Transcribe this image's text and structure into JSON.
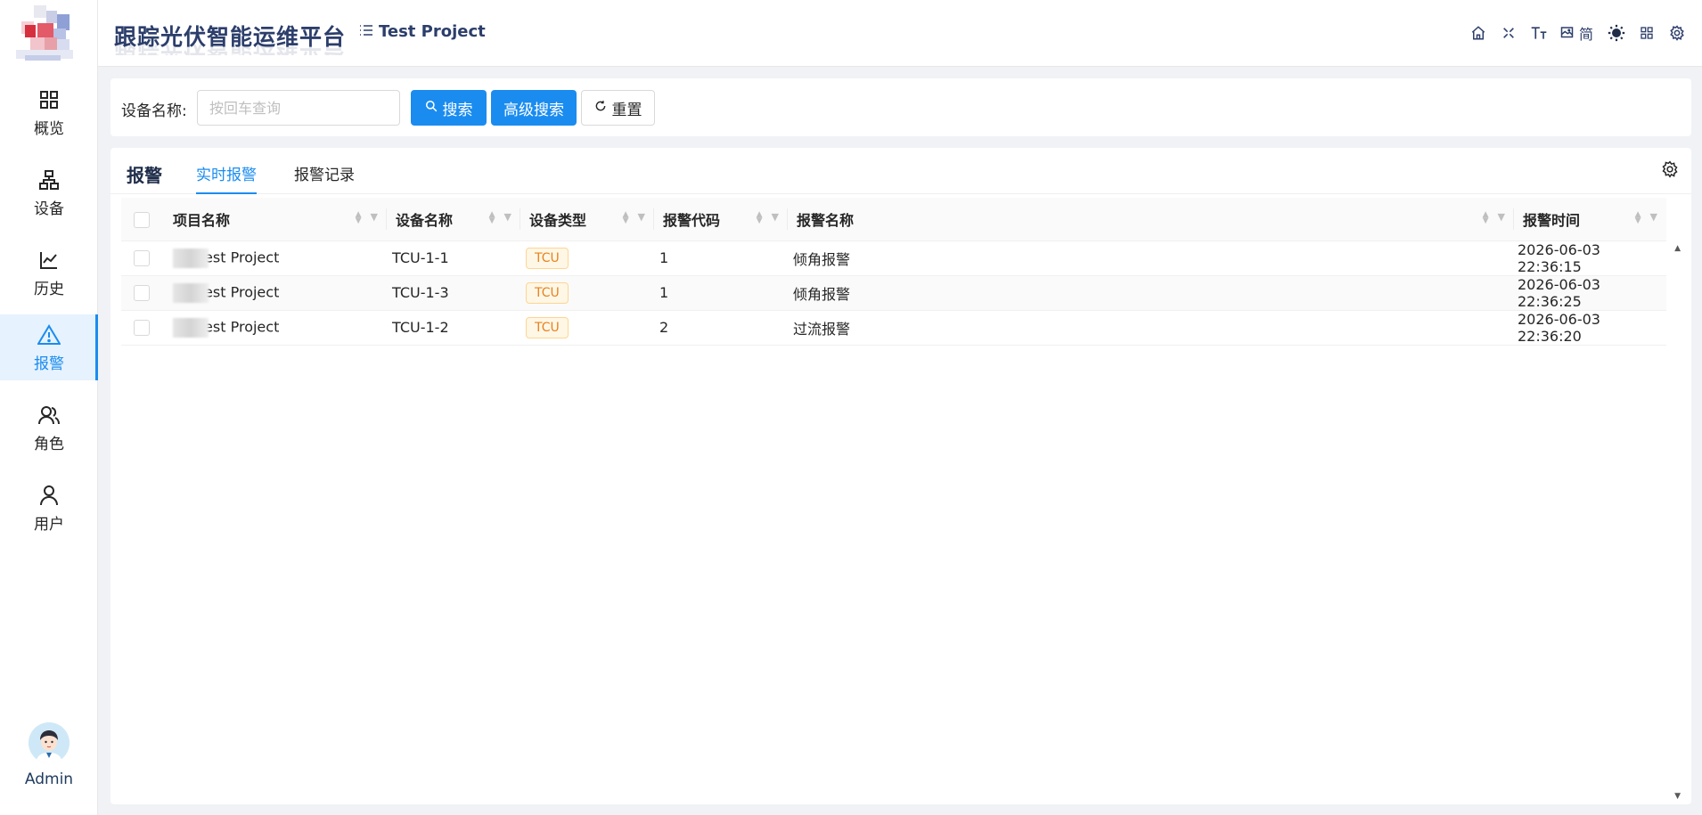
{
  "app": {
    "title": "跟踪光伏智能运维平台",
    "project": "Test Project"
  },
  "sidebar": {
    "items": [
      {
        "label": "概览",
        "icon": "grid-icon"
      },
      {
        "label": "设备",
        "icon": "hierarchy-icon"
      },
      {
        "label": "历史",
        "icon": "line-chart-icon"
      },
      {
        "label": "报警",
        "icon": "warning-icon"
      },
      {
        "label": "角色",
        "icon": "role-icon"
      },
      {
        "label": "用户",
        "icon": "user-icon"
      }
    ],
    "active_item": "报警",
    "user": "Admin"
  },
  "header": {
    "icons": [
      "home-icon",
      "fullscreen-icon",
      "font-size-icon",
      "language-icon",
      "theme-icon",
      "layout-icon",
      "settings-icon"
    ],
    "language_label": "简"
  },
  "search": {
    "label": "设备名称:",
    "placeholder": "按回车查询",
    "value": "",
    "search_button": "搜索",
    "advanced_button": "高级搜索",
    "reset_button": "重置"
  },
  "panel": {
    "title": "报警",
    "tabs": [
      "实时报警",
      "报警记录"
    ],
    "active_tab": "实时报警"
  },
  "table": {
    "columns": [
      "项目名称",
      "设备名称",
      "设备类型",
      "报警代码",
      "报警名称",
      "报警时间"
    ],
    "rows": [
      {
        "project": "Test Project",
        "device": "TCU-1-1",
        "type": "TCU",
        "code": "1",
        "name": "倾角报警",
        "time": "2026-06-03 22:36:15"
      },
      {
        "project": "Test Project",
        "device": "TCU-1-3",
        "type": "TCU",
        "code": "1",
        "name": "倾角报警",
        "time": "2026-06-03 22:36:25"
      },
      {
        "project": "Test Project",
        "device": "TCU-1-2",
        "type": "TCU",
        "code": "2",
        "name": "过流报警",
        "time": "2026-06-03 22:36:20"
      }
    ]
  },
  "colors": {
    "primary": "#1a8cf0",
    "title": "#2c3e6b",
    "tag_text": "#e8811c",
    "tag_bg": "#fff7e6"
  }
}
